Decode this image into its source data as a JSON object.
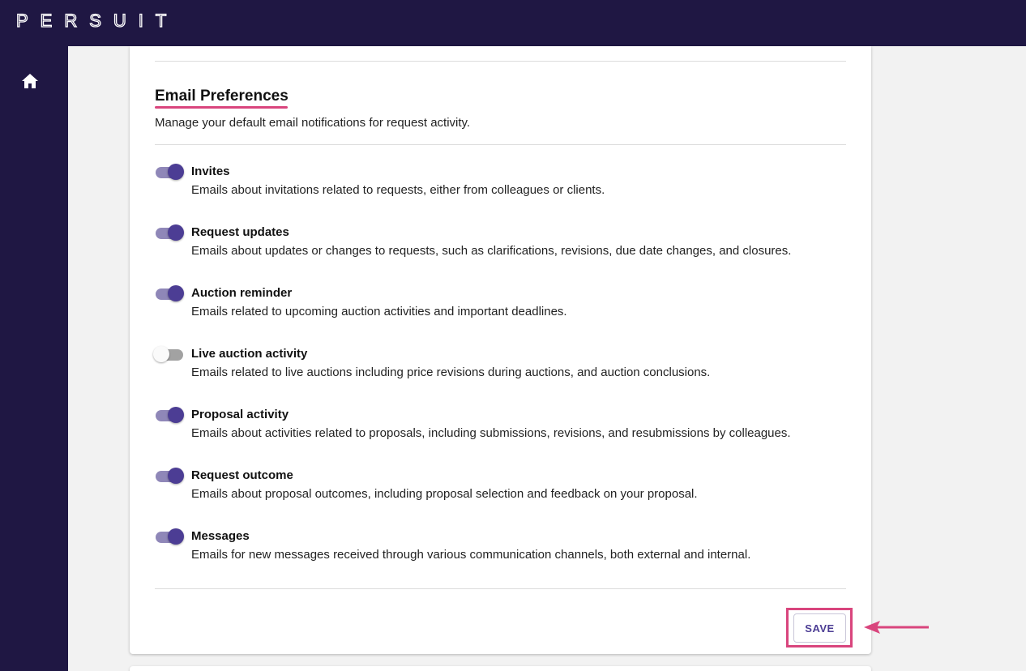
{
  "header": {
    "logo_text": "PERSUIT"
  },
  "sidebar": {
    "home_icon": "home-icon"
  },
  "email_preferences": {
    "title": "Email Preferences",
    "description": "Manage your default email notifications for request activity.",
    "items": [
      {
        "label": "Invites",
        "description": "Emails about invitations related to requests, either from colleagues or clients.",
        "enabled": true
      },
      {
        "label": "Request updates",
        "description": "Emails about updates or changes to requests, such as clarifications, revisions, due date changes, and closures.",
        "enabled": true
      },
      {
        "label": "Auction reminder",
        "description": "Emails related to upcoming auction activities and important deadlines.",
        "enabled": true
      },
      {
        "label": "Live auction activity",
        "description": "Emails related to live auctions including price revisions during auctions, and auction conclusions.",
        "enabled": false
      },
      {
        "label": "Proposal activity",
        "description": "Emails about activities related to proposals, including submissions, revisions, and resubmissions by colleagues.",
        "enabled": true
      },
      {
        "label": "Request outcome",
        "description": "Emails about proposal outcomes, including proposal selection and feedback on your proposal.",
        "enabled": true
      },
      {
        "label": "Messages",
        "description": "Emails for new messages received through various communication channels, both external and internal.",
        "enabled": true
      }
    ],
    "save_label": "SAVE"
  },
  "colors": {
    "nav_background": "#1f1743",
    "accent": "#4c3d94",
    "highlight": "#d9457d"
  }
}
